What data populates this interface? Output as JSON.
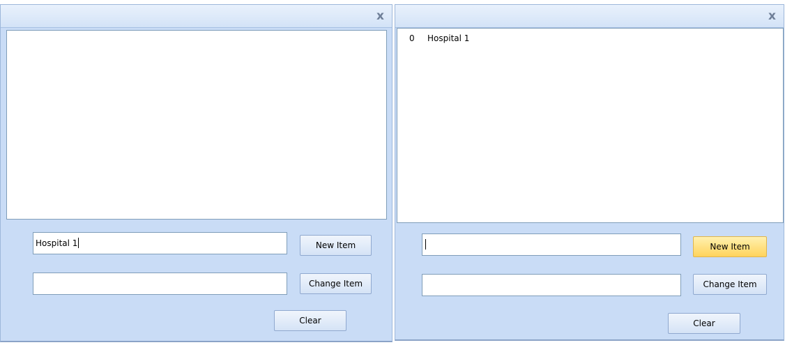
{
  "windows": [
    {
      "id": "left",
      "close_icon": "close-icon",
      "close_glyph": "x",
      "list_items": [],
      "new_item_input": {
        "value": "Hospital 1",
        "placeholder": ""
      },
      "change_item_input": {
        "value": "",
        "placeholder": ""
      },
      "buttons": {
        "new_item": "New Item",
        "change_item": "Change Item",
        "clear": "Clear"
      },
      "new_item_highlighted": false
    },
    {
      "id": "right",
      "close_icon": "close-icon",
      "close_glyph": "x",
      "list_items": [
        {
          "index": "0",
          "text": "Hospital 1"
        }
      ],
      "new_item_input": {
        "value": "",
        "placeholder": ""
      },
      "change_item_input": {
        "value": "",
        "placeholder": ""
      },
      "buttons": {
        "new_item": "New Item",
        "change_item": "Change Item",
        "clear": "Clear"
      },
      "new_item_highlighted": true
    }
  ],
  "colors": {
    "window_bg": "#c9dcf6",
    "titlebar": "#dbe7f8",
    "button_hot": "#ffd35b",
    "border": "#7f9db9"
  }
}
